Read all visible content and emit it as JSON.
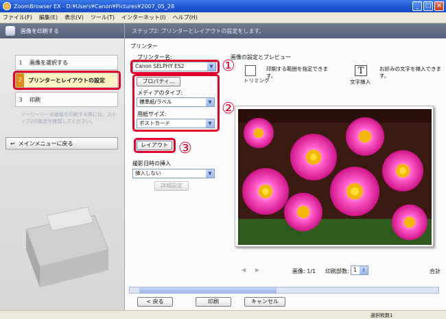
{
  "window": {
    "title": "ZoomBrowser EX - D:¥Users¥Canon¥Pictures¥2007_05_28"
  },
  "menubar": [
    "ファイル(F)",
    "編集(E)",
    "表示(V)",
    "ツール(T)",
    "インターネット(I)",
    "ヘルプ(H)"
  ],
  "left_panel": {
    "header": "画像を印刷する",
    "steps": [
      {
        "num": "1",
        "label": "画像を選択する"
      },
      {
        "num": "2",
        "label": "プリンターとレイアウトの設定"
      },
      {
        "num": "3",
        "label": "印刷"
      }
    ],
    "note": "ソーリーリーの画像を印刷する時には、ステップ2の設定を確認してください。",
    "main_menu_button": "メインメニューに戻る"
  },
  "main": {
    "step_header": "ステップ2: プリンターとレイアウトの設定をします。",
    "printer_section": "プリンター",
    "printer_name_label": "プリンター名:",
    "printer_name_value": "Canon SELPHY ES2",
    "properties_button": "プロパティ...",
    "media_type_label": "メディアのタイプ:",
    "media_type_value": "標準紙/ラベル",
    "paper_size_label": "用紙サイズ:",
    "paper_size_value": "ポストカード",
    "layout_button": "レイアウト",
    "date_section": "撮影日時の挿入",
    "date_value": "挿入しない",
    "date_detail_button": "詳細設定",
    "preview_section": "画像の設定とプレビュー",
    "trim_label": "トリミング",
    "trim_desc": "印刷する範囲を指定できます。",
    "text_label": "文字挿入",
    "text_desc": "お好みの文字を挿入できます。",
    "image_counter": "画像: 1/1",
    "copies_label": "印刷部数:",
    "copies_value": "1",
    "total_label": "合計",
    "back_button": "< 戻る",
    "print_button": "印刷",
    "cancel_button": "キャンセル",
    "status_text": "選択枚数1"
  },
  "annotations": {
    "callout_1": "①",
    "callout_2": "②",
    "callout_3": "③",
    "color": "#e3002b"
  }
}
